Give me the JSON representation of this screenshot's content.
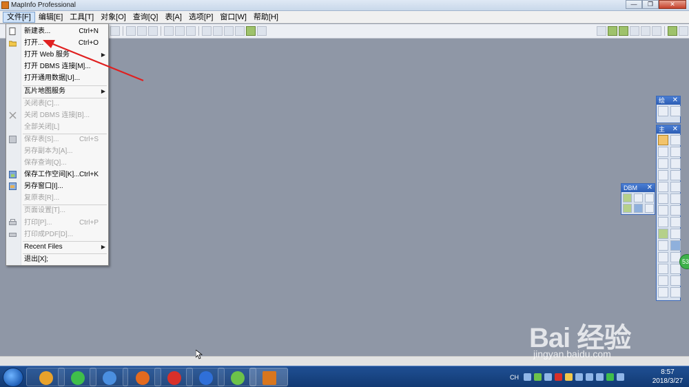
{
  "window": {
    "title": "MapInfo Professional",
    "controls": {
      "minimize": "—",
      "maximize": "❐",
      "close": "✕"
    }
  },
  "menubar": {
    "items": [
      {
        "label": "文件[F]",
        "active": true
      },
      {
        "label": "编辑[E]"
      },
      {
        "label": "工具[T]"
      },
      {
        "label": "对象[O]"
      },
      {
        "label": "查询[Q]"
      },
      {
        "label": "表[A]"
      },
      {
        "label": "选项[P]"
      },
      {
        "label": "窗口[W]"
      },
      {
        "label": "帮助[H]"
      }
    ]
  },
  "file_menu": {
    "items": [
      {
        "label": "新建表...",
        "shortcut": "Ctrl+N",
        "icon": "new-table-icon"
      },
      {
        "label": "打开...",
        "shortcut": "Ctrl+O",
        "icon": "open-folder-icon"
      },
      {
        "label": "打开 Web 服务",
        "submenu": true
      },
      {
        "label": "打开 DBMS 连接[M]..."
      },
      {
        "label": "打开通用数据[U]..."
      },
      {
        "label": "瓦片地图服务",
        "submenu": true
      },
      {
        "label": "关闭表[C]...",
        "disabled": true
      },
      {
        "label": "关闭 DBMS 连接[B]...",
        "disabled": true,
        "icon": "close-dbms-icon"
      },
      {
        "label": "全部关闭[L]",
        "disabled": true
      },
      {
        "label": "保存表[S]...",
        "shortcut": "Ctrl+S",
        "disabled": true,
        "icon": "save-icon"
      },
      {
        "label": "另存副本为[A]...",
        "disabled": true
      },
      {
        "label": "保存查询[Q]...",
        "disabled": true
      },
      {
        "label": "保存工作空间[K]...",
        "shortcut": "Ctrl+K",
        "icon": "save-workspace-icon"
      },
      {
        "label": "另存窗口[I]..."
      },
      {
        "label": "复原表[R]...",
        "disabled": true
      },
      {
        "label": "页面设置[T]...",
        "disabled": true
      },
      {
        "label": "打印[P]...",
        "shortcut": "Ctrl+P",
        "disabled": true,
        "icon": "print-icon"
      },
      {
        "label": "打印成PDF[D]...",
        "disabled": true,
        "icon": "print-pdf-icon"
      },
      {
        "label": "Recent Files",
        "submenu": true
      },
      {
        "label": "退出[X];"
      }
    ]
  },
  "palettes": {
    "small_top": {
      "title": "绘",
      "close": "✕"
    },
    "main_tools": {
      "title": "主",
      "close": "✕"
    },
    "dbm": {
      "title": "DBM",
      "close": "✕"
    }
  },
  "badge": {
    "value": "53"
  },
  "watermark": {
    "brand": "Bai 经验",
    "url": "jingyan.baidu.com"
  },
  "taskbar": {
    "lang": "CH",
    "time": "8:57",
    "date": "2018/3/27",
    "apps": [
      "browser-icon",
      "wechat-icon",
      "feishu-icon",
      "firefox-icon",
      "app-red-icon",
      "baidu-icon",
      "update-icon",
      "mapinfo-icon"
    ]
  },
  "colors": {
    "workspace": "#8f97a6",
    "taskbar": "#1f4f93",
    "annotation_arrow": "#e02020"
  }
}
